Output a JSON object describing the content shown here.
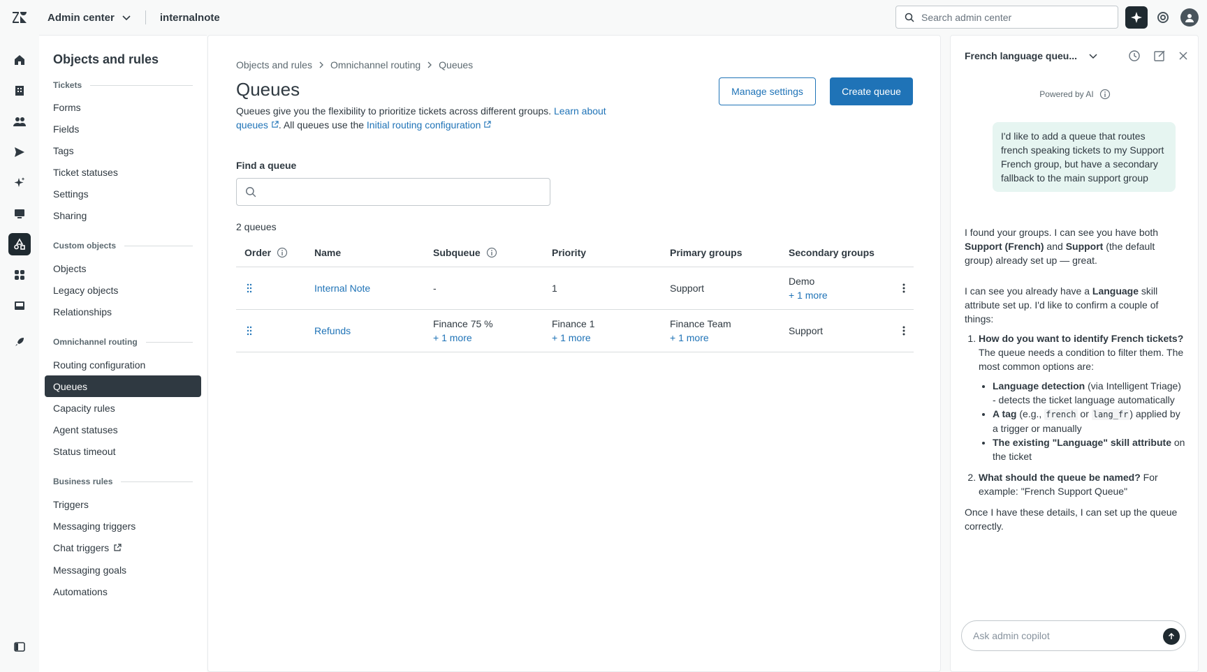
{
  "topbar": {
    "product": "Admin center",
    "account": "internalnote",
    "search_placeholder": "Search admin center"
  },
  "subnav": {
    "title": "Objects and rules",
    "sections": {
      "tickets": "Tickets",
      "custom_objects": "Custom objects",
      "omnichannel": "Omnichannel routing",
      "business_rules": "Business rules"
    },
    "items": {
      "forms": "Forms",
      "fields": "Fields",
      "tags": "Tags",
      "ticket_statuses": "Ticket statuses",
      "settings": "Settings",
      "sharing": "Sharing",
      "objects": "Objects",
      "legacy_objects": "Legacy objects",
      "relationships": "Relationships",
      "routing_configuration": "Routing configuration",
      "queues": "Queues",
      "capacity_rules": "Capacity rules",
      "agent_statuses": "Agent statuses",
      "status_timeout": "Status timeout",
      "triggers": "Triggers",
      "messaging_triggers": "Messaging triggers",
      "chat_triggers": "Chat triggers",
      "messaging_goals": "Messaging goals",
      "automations": "Automations"
    }
  },
  "main": {
    "breadcrumb": [
      "Objects and rules",
      "Omnichannel routing",
      "Queues"
    ],
    "title": "Queues",
    "desc_part1": "Queues give you the flexibility to prioritize tickets across different groups. ",
    "desc_link1": "Learn about queues",
    "desc_part2": ". All queues use the ",
    "desc_link2": "Initial routing configuration",
    "manage_settings": "Manage settings",
    "create_queue": "Create queue",
    "find_label": "Find a queue",
    "count": "2 queues",
    "columns": {
      "order": "Order",
      "name": "Name",
      "subqueue": "Subqueue",
      "priority": "Priority",
      "primary": "Primary groups",
      "secondary": "Secondary groups"
    },
    "rows": [
      {
        "name": "Internal Note",
        "subqueue": "-",
        "subqueue_more": "",
        "priority": "1",
        "priority_more": "",
        "primary": "Support",
        "primary_more": "",
        "secondary": "Demo",
        "secondary_more": "+ 1 more"
      },
      {
        "name": "Refunds",
        "subqueue": "Finance 75 %",
        "subqueue_more": "+ 1 more",
        "priority": "Finance 1",
        "priority_more": "+ 1 more",
        "primary": "Finance Team",
        "primary_more": "+ 1 more",
        "secondary": "Support",
        "secondary_more": ""
      }
    ]
  },
  "copilot": {
    "title": "French language queu...",
    "powered": "Powered by AI",
    "user_msg": "I'd like to add a queue that routes french speaking tickets to my Support French group, but have a secondary fallback to the main support group",
    "a1_pre": "I found your groups. I can see you have both ",
    "a1_b1": "Support (French)",
    "a1_mid": " and ",
    "a1_b2": "Support",
    "a1_post": " (the default group) already set up — great.",
    "a2_pre": "I can see you already have a ",
    "a2_b": "Language",
    "a2_post": " skill attribute set up. I'd like to confirm a couple of things:",
    "q1_b": "How do you want to identify French tickets?",
    "q1_rest": " The queue needs a condition to filter them. The most common options are:",
    "opt1_b": "Language detection",
    "opt1_rest": " (via Intelligent Triage) - detects the ticket language automatically",
    "opt2_b": "A tag",
    "opt2_pre": " (e.g., ",
    "opt2_code1": "french",
    "opt2_or": " or ",
    "opt2_code2": "lang_fr",
    "opt2_rest": ") applied by a trigger or manually",
    "opt3_b": "The existing \"Language\" skill attribute",
    "opt3_rest": " on the ticket",
    "q2_b": "What should the queue be named?",
    "q2_rest": " For example: \"French Support Queue\"",
    "closing": "Once I have these details, I can set up the queue correctly.",
    "input_placeholder": "Ask admin copilot"
  },
  "colors": {
    "accent": "#1f73b7",
    "dark": "#2f3941",
    "user_bubble": "#e6f5f1"
  }
}
